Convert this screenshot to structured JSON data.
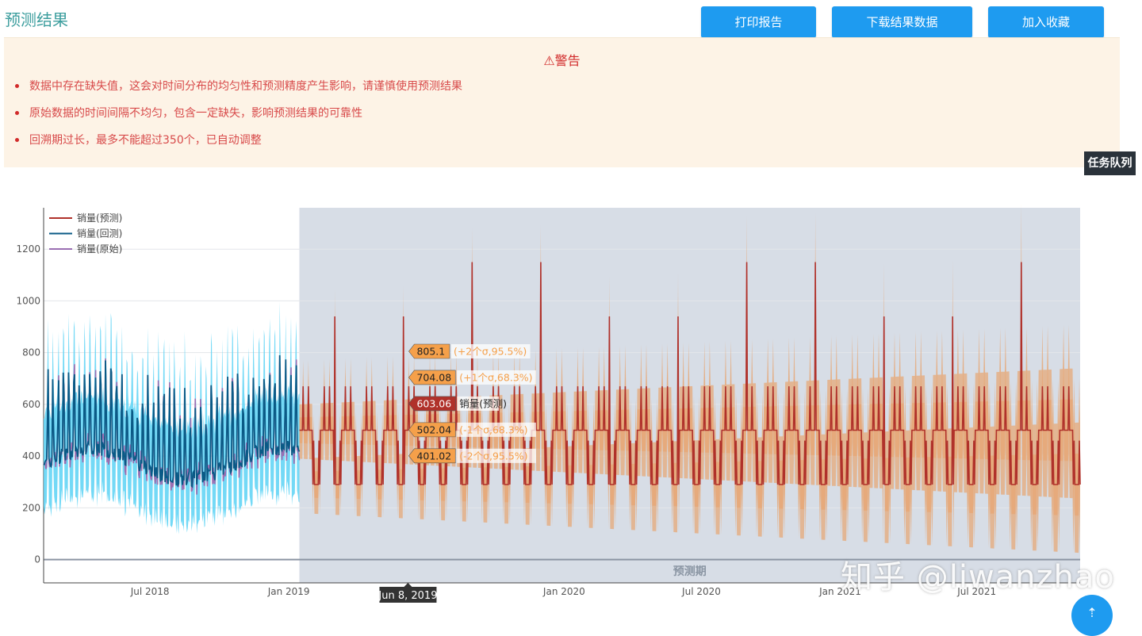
{
  "header": {
    "title": "预测结果",
    "buttons": {
      "print": "打印报告",
      "download": "下载结果数据",
      "favorite": "加入收藏"
    }
  },
  "warning": {
    "title": "⚠警告",
    "items": [
      "数据中存在缺失值，这会对时间分布的均匀性和预测精度产生影响，请谨慎使用预测结果",
      "原始数据的时间间隔不均匀，包含一定缺失，影响预测结果的可靠性",
      "回溯期过长，最多不能超过350个，已自动调整"
    ],
    "color": "#d12a2a"
  },
  "task_queue": "任务队列",
  "watermark": "知乎 @liwanzhao",
  "chart_data": {
    "type": "line",
    "y_ticks": [
      0,
      200,
      400,
      600,
      800,
      1000,
      1200
    ],
    "ylim": [
      -90,
      1360
    ],
    "x_ticks": [
      "Jul 2018",
      "Jan 2019",
      "Jan 2020",
      "Jul 2020",
      "Jan 2021",
      "Jul 2021"
    ],
    "xlim": [
      "2018-02-10",
      "2021-11-15"
    ],
    "legend": [
      {
        "name": "销量(预测)",
        "color": "#b0312a"
      },
      {
        "name": "销量(回测)",
        "color": "#0a5a86"
      },
      {
        "name": "销量(原始)",
        "color": "#9a6fb2"
      }
    ],
    "shaded_region": {
      "label": "预测期",
      "start": "2019-01-15",
      "end": "2021-11-15",
      "color": "#d7dde6"
    },
    "hover": {
      "date": "Jun 8, 2019",
      "labels": [
        {
          "value": "805.1",
          "text": "(+2个σ,95.5%)",
          "color": "#f5a04a"
        },
        {
          "value": "704.08",
          "text": "(+1个σ,68.3%)",
          "color": "#f5a04a"
        },
        {
          "value": "603.06",
          "text": "销量(预测)",
          "color": "#b0312a"
        },
        {
          "value": "502.04",
          "text": "(-1个σ,68.3%)",
          "color": "#f5a04a"
        },
        {
          "value": "401.02",
          "text": "(-2个σ,95.5%)",
          "color": "#f5a04a"
        }
      ]
    },
    "series_notes": {
      "original_backtest_period": [
        "2018-02-10",
        "2019-01-15"
      ],
      "forecast_period": [
        "2019-01-15",
        "2021-11-15"
      ],
      "backtest_level": 370,
      "forecast_baseline": 290,
      "forecast_plateau": 500
    }
  }
}
